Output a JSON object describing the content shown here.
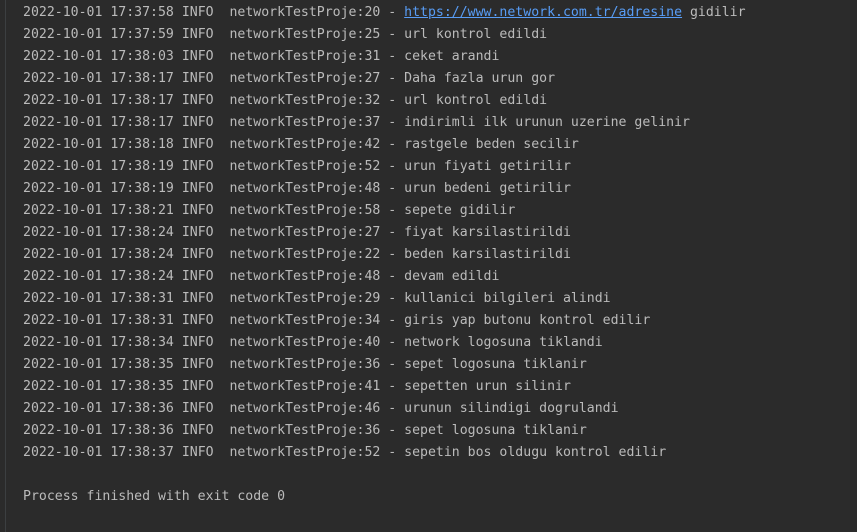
{
  "console": {
    "lines": [
      {
        "time": "2022-10-01 17:37:58",
        "level": "INFO",
        "source": "networkTestProje:20",
        "pre": "",
        "link": "https://www.network.com.tr/adresine",
        "post": " gidilir"
      },
      {
        "time": "2022-10-01 17:37:59",
        "level": "INFO",
        "source": "networkTestProje:25",
        "pre": "url kontrol edildi",
        "link": "",
        "post": ""
      },
      {
        "time": "2022-10-01 17:38:03",
        "level": "INFO",
        "source": "networkTestProje:31",
        "pre": "ceket arandi",
        "link": "",
        "post": ""
      },
      {
        "time": "2022-10-01 17:38:17",
        "level": "INFO",
        "source": "networkTestProje:27",
        "pre": "Daha fazla urun gor",
        "link": "",
        "post": ""
      },
      {
        "time": "2022-10-01 17:38:17",
        "level": "INFO",
        "source": "networkTestProje:32",
        "pre": "url kontrol edildi",
        "link": "",
        "post": ""
      },
      {
        "time": "2022-10-01 17:38:17",
        "level": "INFO",
        "source": "networkTestProje:37",
        "pre": "indirimli ilk urunun uzerine gelinir",
        "link": "",
        "post": ""
      },
      {
        "time": "2022-10-01 17:38:18",
        "level": "INFO",
        "source": "networkTestProje:42",
        "pre": "rastgele beden secilir",
        "link": "",
        "post": ""
      },
      {
        "time": "2022-10-01 17:38:19",
        "level": "INFO",
        "source": "networkTestProje:52",
        "pre": "urun fiyati getirilir",
        "link": "",
        "post": ""
      },
      {
        "time": "2022-10-01 17:38:19",
        "level": "INFO",
        "source": "networkTestProje:48",
        "pre": "urun bedeni getirilir",
        "link": "",
        "post": ""
      },
      {
        "time": "2022-10-01 17:38:21",
        "level": "INFO",
        "source": "networkTestProje:58",
        "pre": "sepete gidilir",
        "link": "",
        "post": ""
      },
      {
        "time": "2022-10-01 17:38:24",
        "level": "INFO",
        "source": "networkTestProje:27",
        "pre": "fiyat karsilastirildi",
        "link": "",
        "post": ""
      },
      {
        "time": "2022-10-01 17:38:24",
        "level": "INFO",
        "source": "networkTestProje:22",
        "pre": "beden karsilastirildi",
        "link": "",
        "post": ""
      },
      {
        "time": "2022-10-01 17:38:24",
        "level": "INFO",
        "source": "networkTestProje:48",
        "pre": "devam edildi",
        "link": "",
        "post": ""
      },
      {
        "time": "2022-10-01 17:38:31",
        "level": "INFO",
        "source": "networkTestProje:29",
        "pre": "kullanici bilgileri alindi",
        "link": "",
        "post": ""
      },
      {
        "time": "2022-10-01 17:38:31",
        "level": "INFO",
        "source": "networkTestProje:34",
        "pre": "giris yap butonu kontrol edilir",
        "link": "",
        "post": ""
      },
      {
        "time": "2022-10-01 17:38:34",
        "level": "INFO",
        "source": "networkTestProje:40",
        "pre": "network logosuna tiklandi",
        "link": "",
        "post": ""
      },
      {
        "time": "2022-10-01 17:38:35",
        "level": "INFO",
        "source": "networkTestProje:36",
        "pre": "sepet logosuna tiklanir",
        "link": "",
        "post": ""
      },
      {
        "time": "2022-10-01 17:38:35",
        "level": "INFO",
        "source": "networkTestProje:41",
        "pre": "sepetten urun silinir",
        "link": "",
        "post": ""
      },
      {
        "time": "2022-10-01 17:38:36",
        "level": "INFO",
        "source": "networkTestProje:46",
        "pre": "urunun silindigi dogrulandi",
        "link": "",
        "post": ""
      },
      {
        "time": "2022-10-01 17:38:36",
        "level": "INFO",
        "source": "networkTestProje:36",
        "pre": "sepet logosuna tiklanir",
        "link": "",
        "post": ""
      },
      {
        "time": "2022-10-01 17:38:37",
        "level": "INFO",
        "source": "networkTestProje:52",
        "pre": "sepetin bos oldugu kontrol edilir",
        "link": "",
        "post": ""
      }
    ],
    "exit_message": "Process finished with exit code 0"
  },
  "colors": {
    "background": "#2b2b2b",
    "text": "#bbbbbb",
    "link": "#589df6"
  }
}
